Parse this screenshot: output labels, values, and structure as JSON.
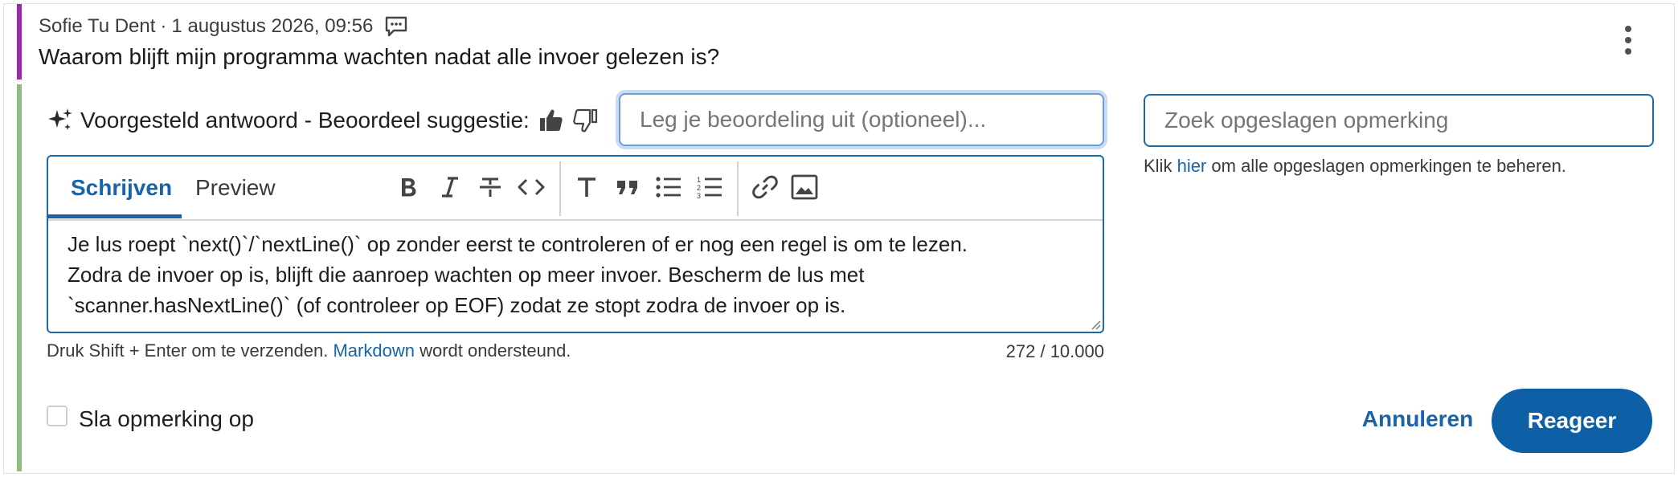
{
  "question": {
    "author": "Sofie Tu Dent",
    "separator": "·",
    "timestamp": "1 augustus 2026, 09:56",
    "text": "Waarom blijft mijn programma wachten nadat alle invoer gelezen is?"
  },
  "suggestion": {
    "label": "Voorgesteld antwoord - Beoordeel suggestie:",
    "rating_placeholder": "Leg je beoordeling uit (optioneel)..."
  },
  "editor": {
    "tabs": {
      "write": "Schrijven",
      "preview": "Preview"
    },
    "toolbar_icons": [
      "bold-icon",
      "italic-icon",
      "strikethrough-icon",
      "code-icon",
      "heading-icon",
      "quote-icon",
      "bulleted-list-icon",
      "numbered-list-icon",
      "link-icon",
      "image-icon"
    ],
    "body": "Je lus roept `next()`/`nextLine()` op zonder eerst te controleren of er nog een regel is om te lezen.\nZodra de invoer op is, blijft die aanroep wachten op meer invoer. Bescherm de lus met\n`scanner.hasNextLine()` (of controleer op EOF) zodat ze stopt zodra de invoer op is.",
    "hint_prefix": "Druk Shift + Enter om te verzenden.",
    "hint_link": "Markdown",
    "hint_suffix": "wordt ondersteund.",
    "counter": "272 / 10.000"
  },
  "save_comment": {
    "label": "Sla opmerking op",
    "checked": false
  },
  "actions": {
    "cancel": "Annuleren",
    "reply": "Reageer"
  },
  "saved_comments": {
    "search_placeholder": "Zoek opgeslagen opmerking",
    "hint_prefix": "Klik",
    "hint_link": "hier",
    "hint_suffix": "om alle opgeslagen opmerkingen te beheren."
  },
  "colors": {
    "question_bar": "#9c27b0",
    "answer_bar": "#8fbc7f",
    "accent": "#1a63a6",
    "primary_button": "#0d5fa6"
  }
}
